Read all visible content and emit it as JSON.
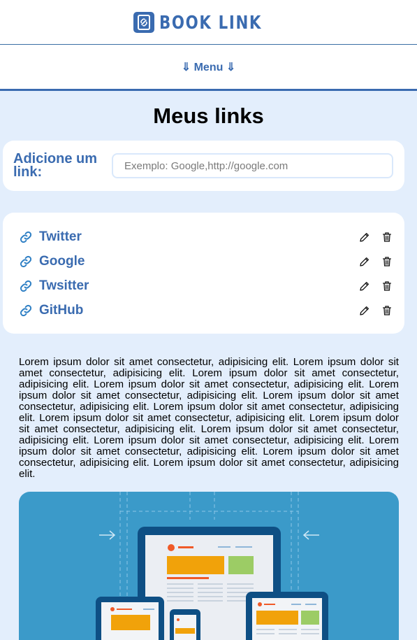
{
  "header": {
    "logo_text": "BOOK LINK",
    "logo_icon": "book-link-icon"
  },
  "menu": {
    "label": "⇓ Menu ⇓"
  },
  "page": {
    "title": "Meus links"
  },
  "add_link": {
    "label": "Adicione um link:",
    "placeholder": "Exemplo: Google,http://google.com",
    "value": ""
  },
  "links": [
    {
      "name": "Twitter"
    },
    {
      "name": "Google"
    },
    {
      "name": "Twsitter"
    },
    {
      "name": "GitHub"
    }
  ],
  "body_text": "Lorem ipsum dolor sit amet consectetur, adipisicing elit. Lorem ipsum dolor sit amet consectetur, adipisicing elit. Lorem ipsum dolor sit amet consectetur, adipisicing elit. Lorem ipsum dolor sit amet consectetur, adipisicing elit. Lorem ipsum dolor sit amet consectetur, adipisicing elit. Lorem ipsum dolor sit amet consectetur, adipisicing elit. Lorem ipsum dolor sit amet consectetur, adipisicing elit. Lorem ipsum dolor sit amet consectetur, adipisicing elit. Lorem ipsum dolor sit amet consectetur, adipisicing elit. Lorem ipsum dolor sit amet consectetur, adipisicing elit. Lorem ipsum dolor sit amet consectetur, adipisicing elit. Lorem ipsum dolor sit amet consectetur, adipisicing elit. Lorem ipsum dolor sit amet consectetur, adipisicing elit. Lorem ipsum dolor sit amet consectetur, adipisicing elit.",
  "colors": {
    "accent": "#3a6bb0",
    "background": "#e3eefc",
    "illustration_bg": "#3b9ac9"
  }
}
